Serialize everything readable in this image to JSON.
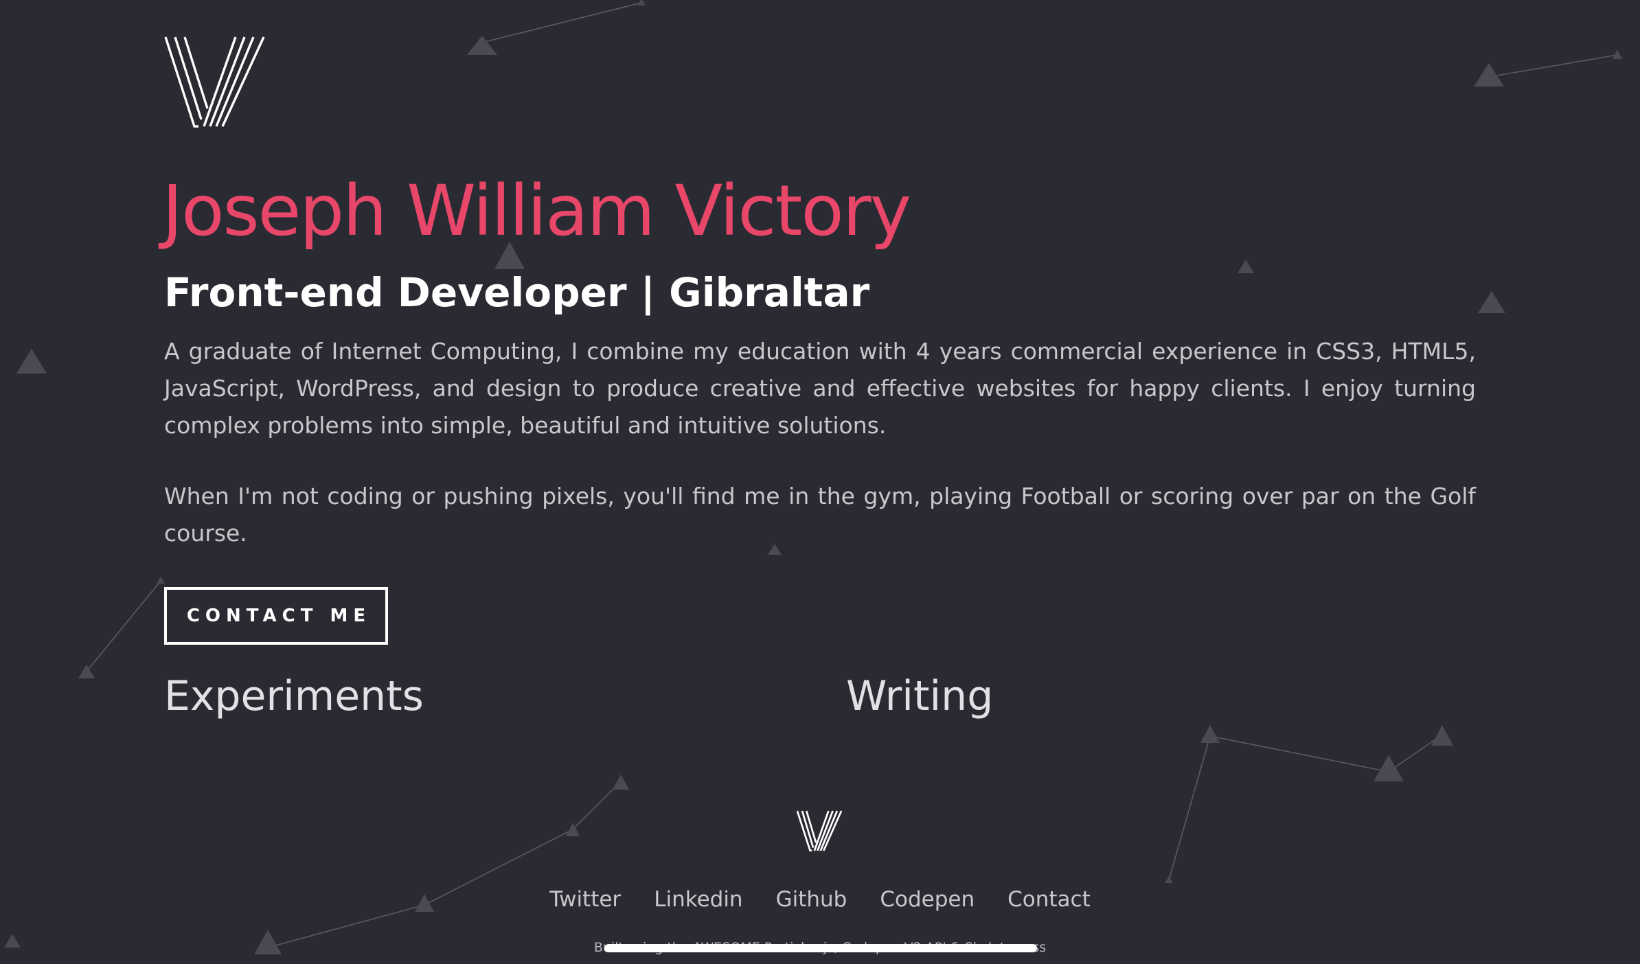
{
  "hero": {
    "name": "Joseph William Victory",
    "role": "Front-end Developer | Gibraltar",
    "bio_1": "A graduate of Internet Computing, I combine my education with 4 years commercial experience in CSS3, HTML5, JavaScript, WordPress, and design to produce creative and effective websites for happy clients. I enjoy turning complex problems into simple, beautiful and intuitive solutions.",
    "bio_2": "When I'm not coding or pushing pixels, you'll find me in the gym, playing Football or scoring over par on the Golf course.",
    "contact_label": "CONTACT ME"
  },
  "sections": {
    "experiments": "Experiments",
    "writing": "Writing"
  },
  "footer": {
    "links": [
      "Twitter",
      "Linkedin",
      "Github",
      "Codepen",
      "Contact"
    ],
    "credit": "Built using the AWESOME Particles.js, Codepen V2 API & Skeleton css"
  },
  "colors": {
    "background": "#2a2b32",
    "accent": "#e8476a",
    "heading": "#ffffff",
    "body_text": "#c8c8cc",
    "particle": "#4a4b52"
  },
  "icons": {
    "logo": "striped-v-logo",
    "footer_logo": "striped-v-logo"
  }
}
